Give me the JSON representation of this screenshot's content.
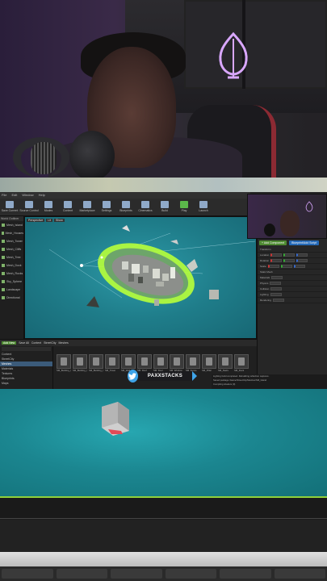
{
  "colors": {
    "viewport_bg": "#1f7d8a",
    "selection_outline": "#b8ff3a",
    "twitter_blue": "#3fa4e8",
    "add_button_green": "#4e8a32",
    "blueprint_button_blue": "#2569b6"
  },
  "webcam": {
    "scene": "streamer-webcam",
    "neon_icon": "leaf-icon"
  },
  "editor": {
    "menu": [
      "File",
      "Edit",
      "Window",
      "Help"
    ],
    "toolbar": [
      {
        "label": "Save Current",
        "icon": "save-icon"
      },
      {
        "label": "Source Control",
        "icon": "source-control-icon"
      },
      {
        "label": "Modes",
        "icon": "modes-icon"
      },
      {
        "label": "Content",
        "icon": "content-icon"
      },
      {
        "label": "Marketplace",
        "icon": "marketplace-icon"
      },
      {
        "label": "Settings",
        "icon": "settings-icon"
      },
      {
        "label": "Blueprints",
        "icon": "blueprint-icon"
      },
      {
        "label": "Cinematics",
        "icon": "cinematics-icon"
      },
      {
        "label": "Build",
        "icon": "build-icon"
      },
      {
        "label": "Play",
        "icon": "play-icon"
      },
      {
        "label": "Launch",
        "icon": "launch-icon"
      }
    ],
    "outliner": {
      "header": "World Outliner",
      "rows": [
        "Mesh_Island",
        "Mesh_Houses",
        "Mesh_Tower",
        "Mesh_Cliffs",
        "Mesh_Tree",
        "Mesh_Dock",
        "Mesh_Rocks",
        "Sky_Sphere",
        "Landscape",
        "Directional"
      ]
    },
    "viewport": {
      "header": [
        "Perspective",
        "Lit",
        "Show"
      ]
    },
    "details": {
      "add_label": "+ Add Component",
      "blueprint_label": "Blueprint/Add Script",
      "rows": [
        "Transform",
        "Location",
        "Rotation",
        "Scale",
        "Static Mesh",
        "Materials",
        "Physics",
        "Collision",
        "Lighting",
        "Rendering"
      ]
    },
    "content_browser": {
      "add_label": "Add New",
      "save_label": "Save All",
      "path": [
        "Content",
        "StreetCity",
        "Meshes"
      ],
      "folders": [
        "Content",
        "StreetCity",
        "Meshes",
        "Materials",
        "Textures",
        "Blueprints",
        "Maps",
        "Audio"
      ],
      "selected_folder": "Meshes",
      "items": [
        "SM_Building_01",
        "SM_Building_02",
        "SM_Building_03",
        "SM_Tower",
        "SM_Wall",
        "SM_Roof",
        "SM_Door",
        "SM_Window",
        "SM_Fence",
        "SM_Pillar",
        "SM_Stairs",
        "SM_Dock"
      ]
    },
    "social": {
      "icon": "twitter-icon",
      "handle": "PAXXSTACKS"
    },
    "log": [
      "Lighting build completed. Rebuilding reflection captures.",
      "Saved package /Game/StreetCity/Meshes/SM_Island",
      "Compiling shaders (0)"
    ],
    "pip_camera": {
      "neon_icon": "leaf-icon"
    }
  },
  "zoom_view": {
    "object": "selected-mesh"
  }
}
